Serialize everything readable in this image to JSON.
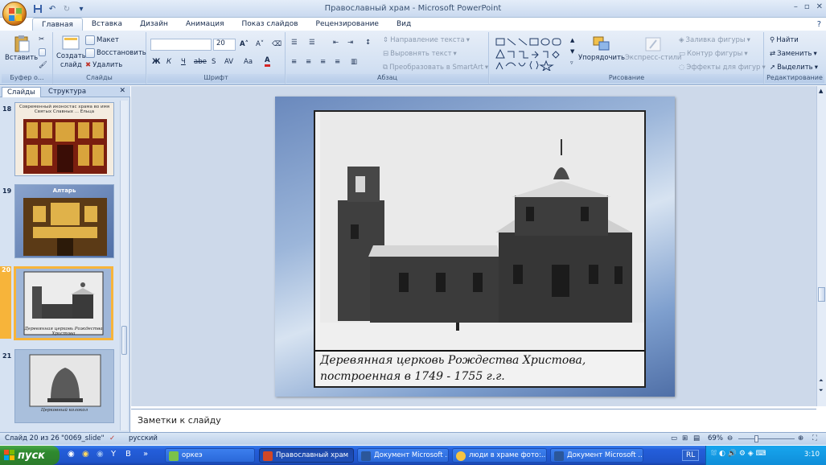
{
  "window": {
    "title": "Православный храм - Microsoft PowerPoint",
    "min": "–",
    "restore": "▫",
    "close": "✕"
  },
  "tabs": [
    "Главная",
    "Вставка",
    "Дизайн",
    "Анимация",
    "Показ слайдов",
    "Рецензирование",
    "Вид"
  ],
  "ribbon": {
    "clipboard": {
      "label": "Буфер о...",
      "paste": "Вставить"
    },
    "slides": {
      "label": "Слайды",
      "create": "Создать",
      "create2": "слайд",
      "layout": "Макет",
      "reset": "Восстановить",
      "delete": "Удалить"
    },
    "font": {
      "label": "Шрифт",
      "size": "20",
      "bold": "Ж",
      "italic": "К",
      "underline": "Ч",
      "strike": "abe",
      "shadow": "S",
      "spacing": "AV",
      "case": "Aa",
      "color": "A"
    },
    "paragraph": {
      "label": "Абзац",
      "text_direction": "Направление текста",
      "align_text": "Выровнять текст",
      "smartart": "Преобразовать в SmartArt"
    },
    "drawing": {
      "label": "Рисование",
      "arrange": "Упорядочить",
      "quick_styles": "Экспресс-стили",
      "fill": "Заливка фигуры",
      "outline": "Контур фигуры",
      "effects": "Эффекты для фигур"
    },
    "editing": {
      "label": "Редактирование",
      "find": "Найти",
      "replace": "Заменить",
      "select": "Выделить"
    }
  },
  "panel": {
    "tab_slides": "Слайды",
    "tab_outline": "Структура",
    "thumbs": [
      {
        "num": "18",
        "title": "Современный иконостас храма во имя Святых Славных ... Ельца"
      },
      {
        "num": "19",
        "title": "Алтарь"
      },
      {
        "num": "20",
        "title": "Деревянная церковь Рождества Христова"
      },
      {
        "num": "21",
        "title": "Церковный колокол"
      }
    ]
  },
  "slide": {
    "caption_line1": "Деревянная церковь Рождества Христова,",
    "caption_line2": "построенная в 1749 - 1755 г.г."
  },
  "notes": {
    "placeholder": "Заметки к слайду"
  },
  "status": {
    "slide_info": "Слайд 20 из 26",
    "theme": "\"0069_slide\"",
    "language": "русский",
    "zoom": "69%"
  },
  "taskbar": {
    "start": "пуск",
    "items": [
      "оркеэ",
      "Православный храм",
      "Документ Microsoft ...",
      "люди в храме фото:...",
      "Документ Microsoft ..."
    ],
    "lang": "RL",
    "clock": "3:10"
  },
  "colors": {
    "accent": "#f7b43a",
    "ribbon": "#d2e0f2",
    "taskbar": "#245edb"
  }
}
